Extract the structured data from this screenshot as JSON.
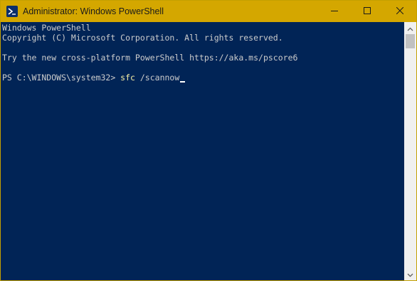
{
  "window": {
    "title": "Administrator: Windows PowerShell",
    "titlebar_color": "#d4a700",
    "console_background": "#012456",
    "app_icon": "powershell-icon",
    "controls": {
      "minimize_icon": "minimize-icon",
      "maximize_icon": "maximize-icon",
      "close_icon": "close-icon"
    }
  },
  "console": {
    "lines": [
      "Windows PowerShell",
      "Copyright (C) Microsoft Corporation. All rights reserved.",
      "Try the new cross-platform PowerShell https://aka.ms/pscore6"
    ],
    "prompt": "PS C:\\WINDOWS\\system32> ",
    "command": {
      "name": "sfc",
      "argument": " /scannow"
    },
    "text_color": "#cccccc",
    "command_color": "#f9f1a5"
  },
  "scrollbar": {
    "up_icon": "scroll-up-arrow-icon",
    "down_icon": "scroll-down-arrow-icon"
  }
}
